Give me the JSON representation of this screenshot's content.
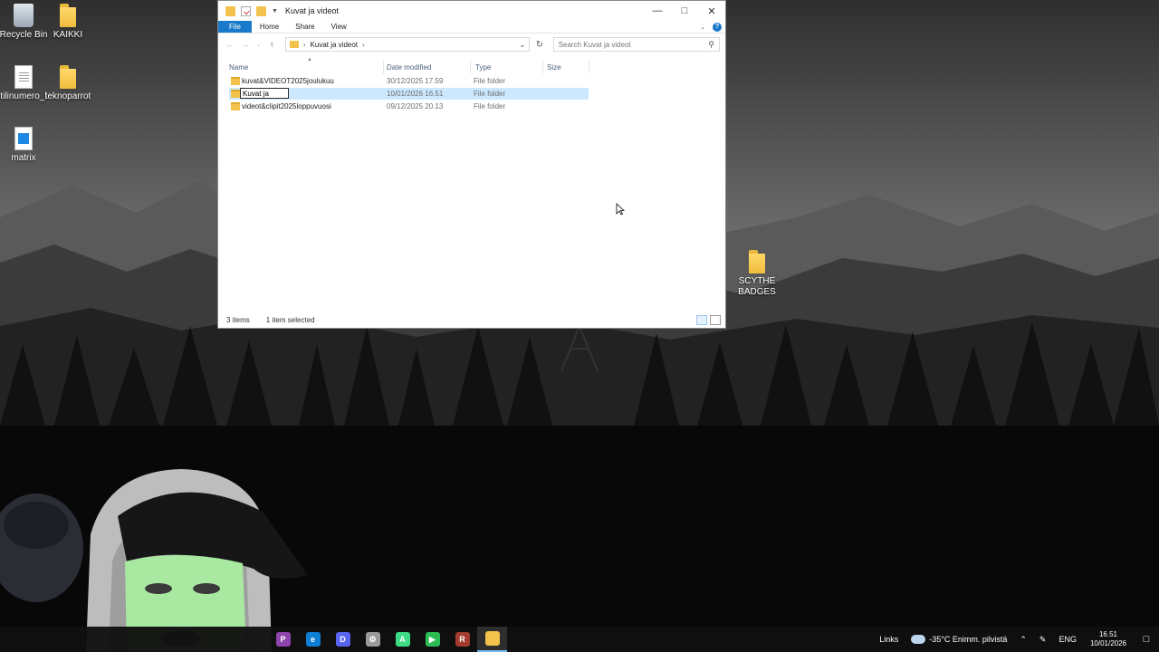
{
  "desktop": {
    "icons": [
      {
        "label": "Recycle Bin",
        "icon": "recycle-bin-icon"
      },
      {
        "label": "KAIKKI",
        "icon": "folder-icon"
      },
      {
        "label": "tilinumero_l",
        "icon": "text-document-icon"
      },
      {
        "label": "teknoparrot",
        "icon": "folder-icon"
      },
      {
        "label": "matrix",
        "icon": "image-file-icon"
      },
      {
        "label": "SCYTHE BADGES",
        "icon": "folder-icon"
      }
    ]
  },
  "explorer": {
    "title": "Kuvat ja videot",
    "ribbon_tabs": [
      "File",
      "Home",
      "Share",
      "View"
    ],
    "address": {
      "path": [
        "Kuvat ja videot"
      ]
    },
    "search": {
      "placeholder": "Search Kuvat ja videot"
    },
    "columns": [
      "Name",
      "Date modified",
      "Type",
      "Size"
    ],
    "rows": [
      {
        "name": "kuvat&VIDEOT2025joulukuu",
        "date": "30/12/2025 17.59",
        "type": "File folder",
        "size": ""
      },
      {
        "name": "Kuvat ja",
        "date": "10/01/2026 16.51",
        "type": "File folder",
        "size": "",
        "selected": true,
        "renaming": true
      },
      {
        "name": "videot&clipit2025loppuvuosi",
        "date": "09/12/2025 20.13",
        "type": "File folder",
        "size": ""
      }
    ],
    "status": {
      "items": "3 items",
      "selected": "1 item selected"
    }
  },
  "taskbar": {
    "apps": [
      {
        "name": "photos",
        "color": "#8e44ad",
        "glyph": "P"
      },
      {
        "name": "edge",
        "color": "#0f7fd6",
        "glyph": "e"
      },
      {
        "name": "discord",
        "color": "#5865f2",
        "glyph": "D"
      },
      {
        "name": "settings",
        "color": "#9a9a9a",
        "glyph": "⚙"
      },
      {
        "name": "android-studio",
        "color": "#3ddc84",
        "glyph": "A"
      },
      {
        "name": "media-player",
        "color": "#2bbd54",
        "glyph": "▶"
      },
      {
        "name": "winrar",
        "color": "#a33b2e",
        "glyph": "R"
      },
      {
        "name": "file-explorer",
        "color": "#f3c24c",
        "glyph": ""
      }
    ],
    "tray": {
      "links": "Links",
      "weather": "-35°C  Enimm. pilvistä",
      "lang": "ENG",
      "time": "16.51",
      "date": "10/01/2026"
    }
  }
}
